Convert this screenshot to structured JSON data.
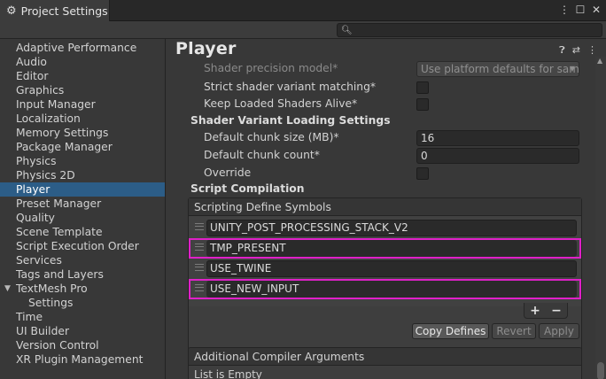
{
  "window": {
    "title": "Project Settings",
    "search_placeholder": ""
  },
  "sidebar": {
    "items": [
      {
        "label": "Adaptive Performance"
      },
      {
        "label": "Audio"
      },
      {
        "label": "Editor"
      },
      {
        "label": "Graphics"
      },
      {
        "label": "Input Manager"
      },
      {
        "label": "Localization"
      },
      {
        "label": "Memory Settings"
      },
      {
        "label": "Package Manager"
      },
      {
        "label": "Physics"
      },
      {
        "label": "Physics 2D"
      },
      {
        "label": "Player",
        "selected": true
      },
      {
        "label": "Preset Manager"
      },
      {
        "label": "Quality"
      },
      {
        "label": "Scene Template"
      },
      {
        "label": "Script Execution Order"
      },
      {
        "label": "Services"
      },
      {
        "label": "Tags and Layers"
      },
      {
        "label": "TextMesh Pro",
        "expanded": true
      },
      {
        "label": "Settings",
        "child": true
      },
      {
        "label": "Time"
      },
      {
        "label": "UI Builder"
      },
      {
        "label": "Version Control"
      },
      {
        "label": "XR Plugin Management"
      }
    ]
  },
  "main": {
    "title": "Player",
    "settings": {
      "shader_precision_label": "Shader precision model*",
      "shader_precision_value": "Use platform defaults for sam",
      "strict_matching_label": "Strict shader variant matching*",
      "keep_loaded_label": "Keep Loaded Shaders Alive*",
      "variant_loading_title": "Shader Variant Loading Settings",
      "chunk_size_label": "Default chunk size (MB)*",
      "chunk_size_value": "16",
      "chunk_count_label": "Default chunk count*",
      "chunk_count_value": "0",
      "override_label": "Override",
      "script_compilation_title": "Script Compilation"
    },
    "define_symbols": {
      "header": "Scripting Define Symbols",
      "items": [
        {
          "value": "UNITY_POST_PROCESSING_STACK_V2",
          "highlighted": false
        },
        {
          "value": "TMP_PRESENT",
          "highlighted": true
        },
        {
          "value": "USE_TWINE",
          "highlighted": false
        },
        {
          "value": "USE_NEW_INPUT",
          "highlighted": true
        }
      ],
      "add_label": "+",
      "remove_label": "−",
      "copy_label": "Copy Defines",
      "revert_label": "Revert",
      "apply_label": "Apply"
    },
    "compiler_args": {
      "header": "Additional Compiler Arguments",
      "empty_text": "List is Empty"
    }
  },
  "colors": {
    "selection": "#2c5d87",
    "highlight": "#e020c8"
  }
}
